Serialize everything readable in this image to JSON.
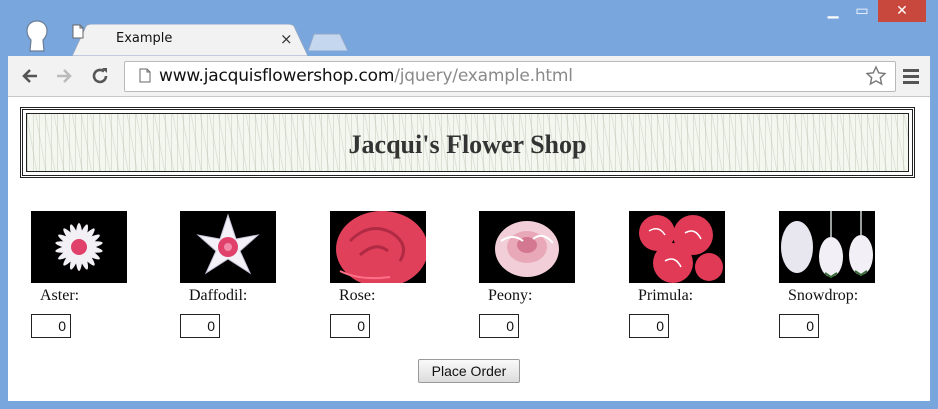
{
  "browser": {
    "tab_title": "Example",
    "tab_close": "×",
    "url_host": "www.jacquisflowershop.com",
    "url_path": "/jquery/example.html",
    "win_min": "▁",
    "win_max": "▭",
    "win_close": "✕"
  },
  "page": {
    "title": "Jacqui's Flower Shop",
    "order_button": "Place Order",
    "flowers": [
      {
        "label": "Aster:",
        "value": "0"
      },
      {
        "label": "Daffodil:",
        "value": "0"
      },
      {
        "label": "Rose:",
        "value": "0"
      },
      {
        "label": "Peony:",
        "value": "0"
      },
      {
        "label": "Primula:",
        "value": "0"
      },
      {
        "label": "Snowdrop:",
        "value": "0"
      }
    ]
  },
  "colors": {
    "window_frame": "#7aa6de",
    "close_button": "#c9483d",
    "banner_text": "#333333"
  }
}
